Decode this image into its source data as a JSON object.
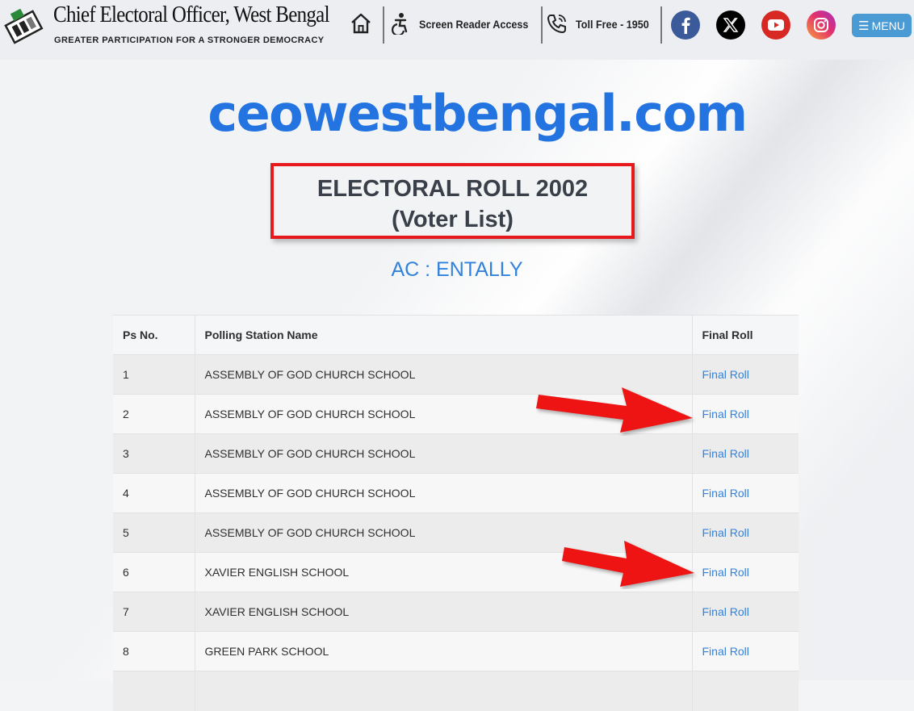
{
  "header": {
    "site_title": "Chief Electoral Officer, West Bengal",
    "tagline": "GREATER PARTICIPATION FOR A STRONGER DEMOCRACY",
    "screen_reader_label": "Screen Reader Access",
    "toll_free_label": "Toll Free - 1950",
    "menu_label": "MENU",
    "icons": {
      "home": "home-icon",
      "accessibility": "accessibility-icon",
      "phone": "phone-icon",
      "facebook": "facebook-icon",
      "x": "x-icon",
      "youtube": "youtube-icon",
      "instagram": "instagram-icon",
      "menu": "hamburger-icon"
    }
  },
  "main": {
    "watermark_domain": "ceowestbengal.com",
    "title_line1": "ELECTORAL ROLL 2002",
    "title_line2": "(Voter List)",
    "ac_label": "AC : ENTALLY"
  },
  "table": {
    "headers": [
      "Ps No.",
      "Polling Station Name",
      "Final Roll"
    ],
    "rows": [
      {
        "ps_no": "1",
        "name": "ASSEMBLY OF GOD CHURCH SCHOOL",
        "link": "Final Roll"
      },
      {
        "ps_no": "2",
        "name": "ASSEMBLY OF GOD CHURCH SCHOOL",
        "link": "Final Roll"
      },
      {
        "ps_no": "3",
        "name": "ASSEMBLY OF GOD CHURCH SCHOOL",
        "link": "Final Roll"
      },
      {
        "ps_no": "4",
        "name": "ASSEMBLY OF GOD CHURCH SCHOOL",
        "link": "Final Roll"
      },
      {
        "ps_no": "5",
        "name": "ASSEMBLY OF GOD CHURCH SCHOOL",
        "link": "Final Roll"
      },
      {
        "ps_no": "6",
        "name": "XAVIER ENGLISH SCHOOL",
        "link": "Final Roll"
      },
      {
        "ps_no": "7",
        "name": "XAVIER ENGLISH SCHOOL",
        "link": "Final Roll"
      },
      {
        "ps_no": "8",
        "name": "GREEN PARK SCHOOL",
        "link": "Final Roll"
      },
      {
        "ps_no": "",
        "name": "",
        "link": ""
      }
    ]
  },
  "colors": {
    "accent_blue": "#3182dc",
    "domain_blue": "#2374e1",
    "highlight_red": "#e8191d",
    "menu_button": "#4a9ad4"
  }
}
